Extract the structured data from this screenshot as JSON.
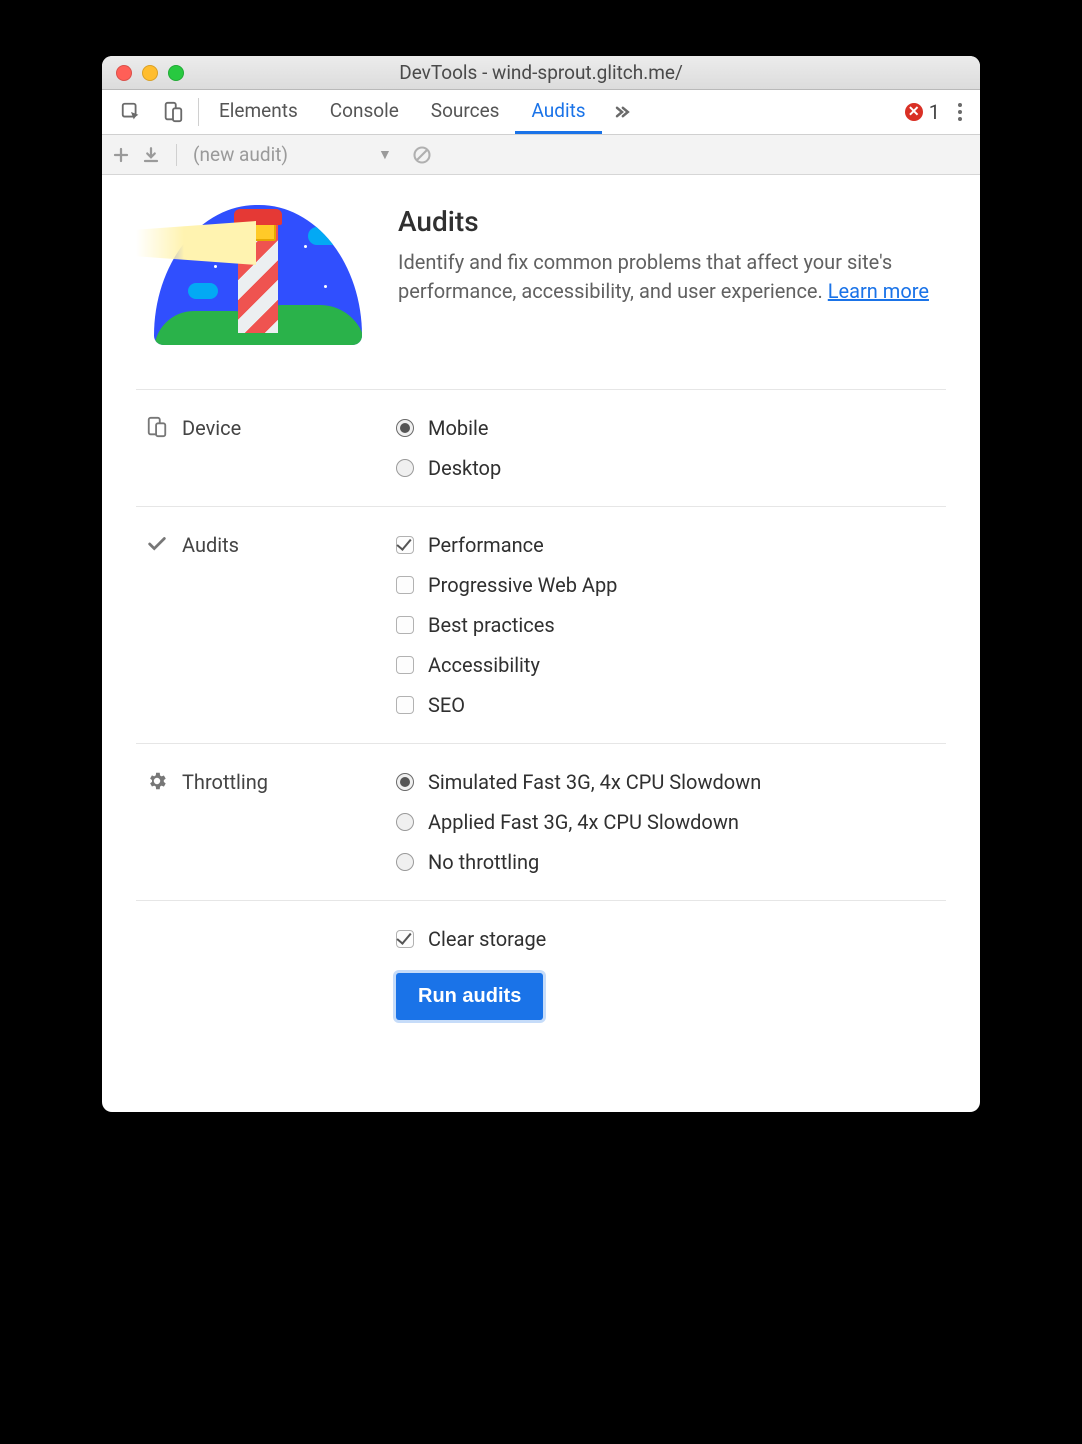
{
  "window": {
    "title": "DevTools - wind-sprout.glitch.me/"
  },
  "tabs": {
    "elements": "Elements",
    "console": "Console",
    "sources": "Sources",
    "audits": "Audits",
    "error_count": "1"
  },
  "subtoolbar": {
    "audit_selector": "(new audit)"
  },
  "hero": {
    "title": "Audits",
    "desc_prefix": "Identify and fix common problems that affect your site's performance, accessibility, and user experience. ",
    "learn_more": "Learn more"
  },
  "sections": {
    "device": {
      "label": "Device",
      "options": {
        "mobile": "Mobile",
        "desktop": "Desktop"
      },
      "selected": "mobile"
    },
    "audits": {
      "label": "Audits",
      "options": {
        "performance": "Performance",
        "pwa": "Progressive Web App",
        "best_practices": "Best practices",
        "accessibility": "Accessibility",
        "seo": "SEO"
      },
      "checked": [
        "performance"
      ]
    },
    "throttling": {
      "label": "Throttling",
      "options": {
        "sim": "Simulated Fast 3G, 4x CPU Slowdown",
        "applied": "Applied Fast 3G, 4x CPU Slowdown",
        "none": "No throttling"
      },
      "selected": "sim"
    },
    "clear_storage": {
      "label": "Clear storage",
      "checked": true
    },
    "run": "Run audits"
  }
}
